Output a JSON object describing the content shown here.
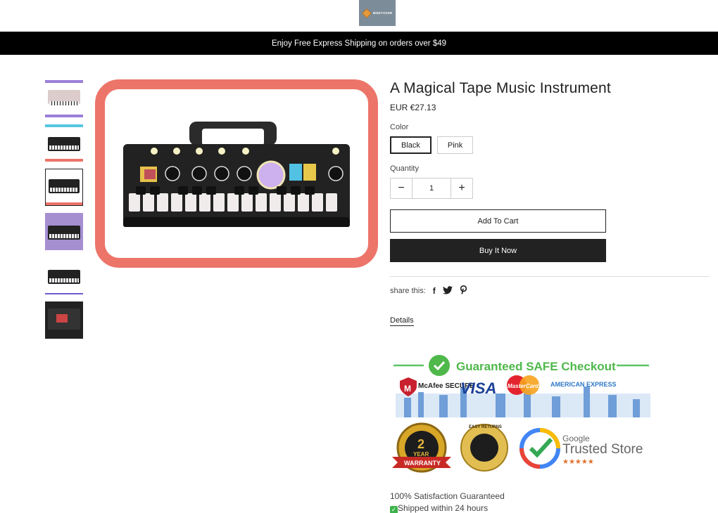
{
  "brand": {
    "logo_text": "MODYVOZR"
  },
  "announcement": "Enjoy Free Express Shipping on orders over $49",
  "product": {
    "title": "A Magical Tape Music Instrument",
    "price": "EUR €27.13",
    "color_label": "Color",
    "colors": [
      "Black",
      "Pink"
    ],
    "selected_color": "Black",
    "quantity_label": "Quantity",
    "quantity": "1",
    "decrement": "−",
    "increment": "+",
    "add_to_cart": "Add To Cart",
    "buy_now": "Buy It Now"
  },
  "share": {
    "label": "share this:",
    "icons": [
      "facebook-icon",
      "twitter-icon",
      "pinterest-icon"
    ]
  },
  "details_link": "Details",
  "trust_badge": {
    "headline": "Guaranteed SAFE Checkout",
    "payment_logos": [
      "McAfee SECURE",
      "VISA",
      "MasterCard",
      "AMERICAN EXPRESS"
    ],
    "warranty_big": "2",
    "warranty_small": "YEAR",
    "warranty_ribbon": "WARRANTY",
    "easy_returns": "EASY RETURNS",
    "google_line1": "Google",
    "google_line2": "Trusted Store",
    "stars": "★★★★★"
  },
  "guarantees": {
    "line1": "100% Satisfaction Guaranteed",
    "line2": "Shipped within 24 hours"
  },
  "thumbnails": [
    {
      "name": "thumb-1",
      "top": "#9a7fd8",
      "bottom": "#9a7fd8"
    },
    {
      "name": "thumb-2",
      "top": "#57c7e0",
      "bottom": "#ec7469"
    },
    {
      "name": "thumb-3",
      "top": "#ffffff",
      "bottom": "#ec7469"
    },
    {
      "name": "thumb-4",
      "top": "#a58fd1",
      "bottom": "#ffffff"
    },
    {
      "name": "thumb-5",
      "top": "#ffffff",
      "bottom": "#ffffff"
    },
    {
      "name": "thumb-6",
      "top": "#222222",
      "bottom": "#222222"
    }
  ],
  "colors": {
    "accent_frame": "#ec7469",
    "dark": "#222222",
    "announce_bg": "#000000",
    "trust_green": "#4fb84a"
  }
}
